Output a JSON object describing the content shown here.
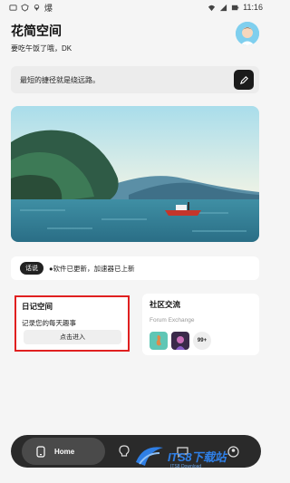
{
  "status_bar": {
    "left_glyph": "爆",
    "time": "11:16"
  },
  "header": {
    "title": "花简空间",
    "greeting": "要吃午饭了哦，DK"
  },
  "quote": {
    "text": "最短的捷径就是绕远路。",
    "action_icon": "pen-icon"
  },
  "banner": {
    "description_icon": "landscape-illustration"
  },
  "notice": {
    "tag": "话说",
    "text": "●软件已更新，加速器已上新"
  },
  "diary_card": {
    "title": "日记空间",
    "subtitle": "记录您的每天趣事",
    "button_label": "点击进入"
  },
  "forum_card": {
    "title": "社区交流",
    "subtitle": "Forum Exchange",
    "count_badge": "99+"
  },
  "nav": {
    "home_label": "Home",
    "items": [
      "home-icon",
      "bulb-icon",
      "chat-icon",
      "profile-icon"
    ]
  },
  "watermark": {
    "logo": "ITS8下载站",
    "sub": "ITS8 Download"
  },
  "colors": {
    "highlight_border": "#e02020",
    "nav_bg": "#2a2a2a",
    "accent_blue": "#2f7fe6"
  }
}
